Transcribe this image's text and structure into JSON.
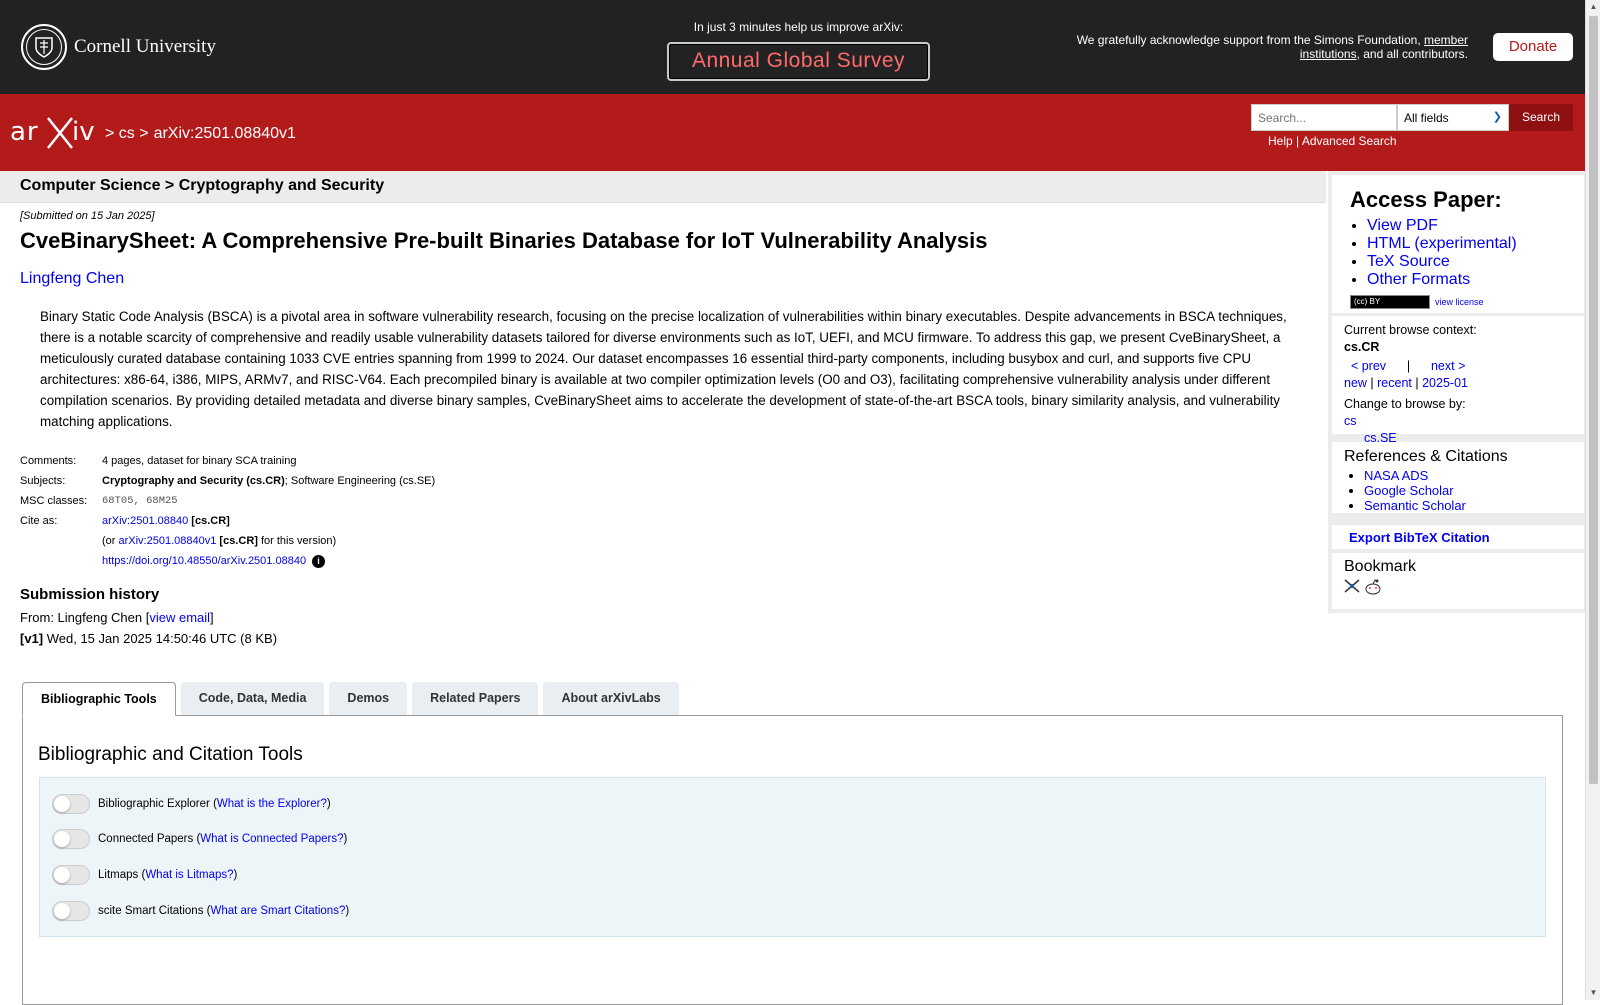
{
  "cornell": {
    "name": "Cornell University"
  },
  "survey": {
    "prompt": "In just 3 minutes help us improve arXiv:",
    "button": "Annual Global Survey"
  },
  "ack": {
    "text_before": "We gratefully acknowledge support from the Simons Foundation, ",
    "link": "member institutions",
    "text_after": ", and all contributors."
  },
  "donate": "Donate",
  "header": {
    "logo": "arXiv",
    "crumb1": "> cs >",
    "crumb2": "arXiv:2501.08840v1",
    "search_placeholder": "Search...",
    "field_select": "All fields",
    "search_btn": "Search",
    "help": "Help",
    "sep": " | ",
    "advanced": "Advanced Search"
  },
  "category": "Computer Science > Cryptography and Security",
  "dateline": "[Submitted on 15 Jan 2025]",
  "title": "CveBinarySheet: A Comprehensive Pre-built Binaries Database for IoT Vulnerability Analysis",
  "author": "Lingfeng Chen",
  "abstract": "Binary Static Code Analysis (BSCA) is a pivotal area in software vulnerability research, focusing on the precise localization of vulnerabilities within binary executables. Despite advancements in BSCA techniques, there is a notable scarcity of comprehensive and readily usable vulnerability datasets tailored for diverse environments such as IoT, UEFI, and MCU firmware. To address this gap, we present CveBinarySheet, a meticulously curated database containing 1033 CVE entries spanning from 1999 to 2024. Our dataset encompasses 16 essential third-party components, including busybox and curl, and supports five CPU architectures: x86-64, i386, MIPS, ARMv7, and RISC-V64. Each precompiled binary is available at two compiler optimization levels (O0 and O3), facilitating comprehensive vulnerability analysis under different compilation scenarios. By providing detailed metadata and diverse binary samples, CveBinarySheet aims to accelerate the development of state-of-the-art BSCA tools, binary similarity analysis, and vulnerability matching applications.",
  "meta": {
    "comments_label": "Comments:",
    "comments": "4 pages, dataset for binary SCA training",
    "subjects_label": "Subjects:",
    "subjects_primary": "Cryptography and Security (cs.CR)",
    "subjects_rest": "; Software Engineering (cs.SE)",
    "msc_label": "MSC classes:",
    "msc": "68T05, 68M25",
    "cite_label": "Cite as:",
    "cite_id": "arXiv:2501.08840",
    "cite_cat": " [cs.CR]",
    "cite_v_pre": "(or ",
    "cite_v_id": "arXiv:2501.08840v1",
    "cite_v_cat": " [cs.CR]",
    "cite_v_post": " for this version)",
    "doi": "https://doi.org/10.48550/arXiv.2501.08840",
    "info_glyph": "i"
  },
  "history": {
    "title": "Submission history",
    "from_pre": "From: Lingfeng Chen [",
    "view_email": "view email",
    "from_post": "]",
    "v1_label": "[v1]",
    "v1_text": " Wed, 15 Jan 2025 14:50:46 UTC (8 KB)"
  },
  "tabs": [
    "Bibliographic Tools",
    "Code, Data, Media",
    "Demos",
    "Related Papers",
    "About arXivLabs"
  ],
  "panel_title": "Bibliographic and Citation Tools",
  "tools": [
    {
      "name": "Bibliographic Explorer",
      "link": "What is the Explorer?"
    },
    {
      "name": "Connected Papers",
      "link": "What is Connected Papers?"
    },
    {
      "name": "Litmaps",
      "link": "What is Litmaps?"
    },
    {
      "name": "scite Smart Citations",
      "link": "What are Smart Citations?"
    }
  ],
  "sidebar": {
    "access_title": "Access Paper:",
    "links": [
      "View PDF",
      "HTML (experimental)",
      "TeX Source",
      "Other Formats"
    ],
    "cc_badge": "(cc) BY",
    "license": "view license",
    "ctx_label": "Current browse context:",
    "ctx_value": "cs.CR",
    "prev": "< prev",
    "pipe": "|",
    "next": "next >",
    "new": "new",
    "recent": "recent",
    "month": "2025-01",
    "change_label": "Change to browse by:",
    "browse_cs": "cs",
    "browse_se": "cs.SE",
    "refs_title": "References & Citations",
    "refs": [
      "NASA ADS",
      "Google Scholar",
      "Semantic Scholar"
    ],
    "bibtex": "Export BibTeX Citation",
    "bookmark": "Bookmark"
  },
  "colors": {
    "arxiv_red": "#b31b1b",
    "cornell_bg": "#222222",
    "survey_text": "#ff6b6b",
    "link": "#0000ee"
  }
}
